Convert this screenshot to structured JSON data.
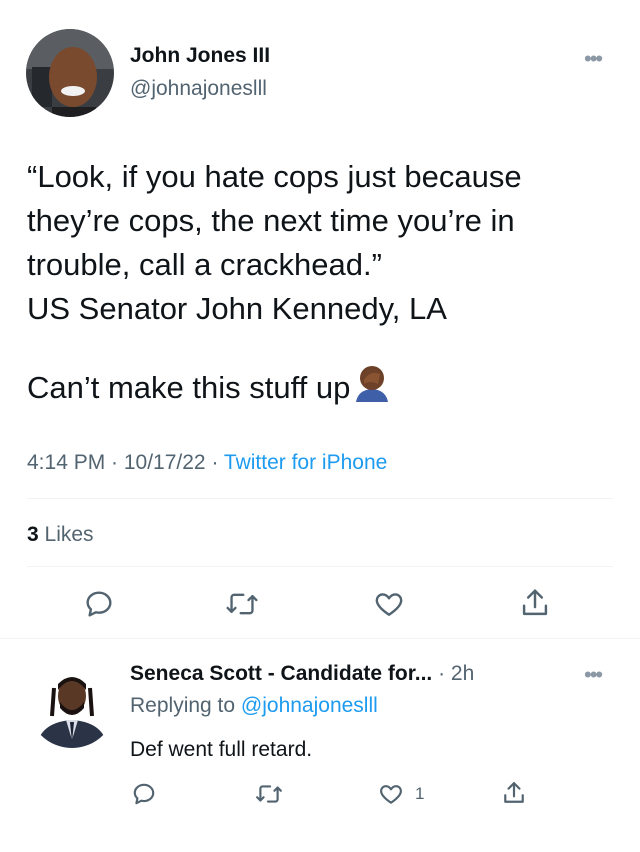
{
  "tweet": {
    "author_name": "John Jones III",
    "author_handle": "@johnajoneslll",
    "more_label": "•••",
    "lines": [
      "“Look, if you hate cops just because",
      "they’re cops, the next time you’re in",
      "trouble, call a crackhead.”",
      "US Senator John Kennedy, LA"
    ],
    "line2": "Can’t make this stuff up",
    "time": "4:14 PM · 10/17/22 · ",
    "source": "Twitter for iPhone",
    "likes_count": "3",
    "likes_label": " Likes",
    "actions": [
      "reply-icon",
      "retweet-icon",
      "like-icon",
      "share-icon"
    ]
  },
  "reply": {
    "author_name": "Seneca Scott - Candidate for...",
    "time": " · 2h",
    "more_label": "•••",
    "replying_prefix": "Replying to ",
    "replying_handle": "@johnajoneslll",
    "text": "Def went full retard.",
    "like_count": "1",
    "actions": [
      "reply-icon",
      "retweet-icon",
      "like-icon",
      "share-icon"
    ]
  }
}
